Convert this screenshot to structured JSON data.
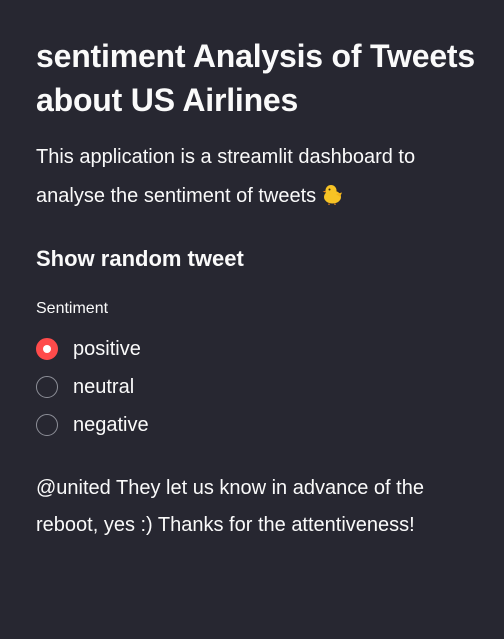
{
  "page": {
    "title": "sentiment Analysis of Tweets about US Airlines",
    "intro": "This application is a streamlit dashboard to analyse the sentiment of tweets",
    "intro_icon": "hatching-chick-icon"
  },
  "section": {
    "heading": "Show random tweet"
  },
  "sentiment": {
    "label": "Sentiment",
    "options": [
      {
        "label": "positive",
        "selected": true
      },
      {
        "label": "neutral",
        "selected": false
      },
      {
        "label": "negative",
        "selected": false
      }
    ],
    "accent_color": "#ff4b4b"
  },
  "tweet": {
    "text": "@united They let us know in advance of the reboot, yes :) Thanks for the attentiveness!"
  },
  "colors": {
    "background": "#272731",
    "text": "#fafafa"
  }
}
